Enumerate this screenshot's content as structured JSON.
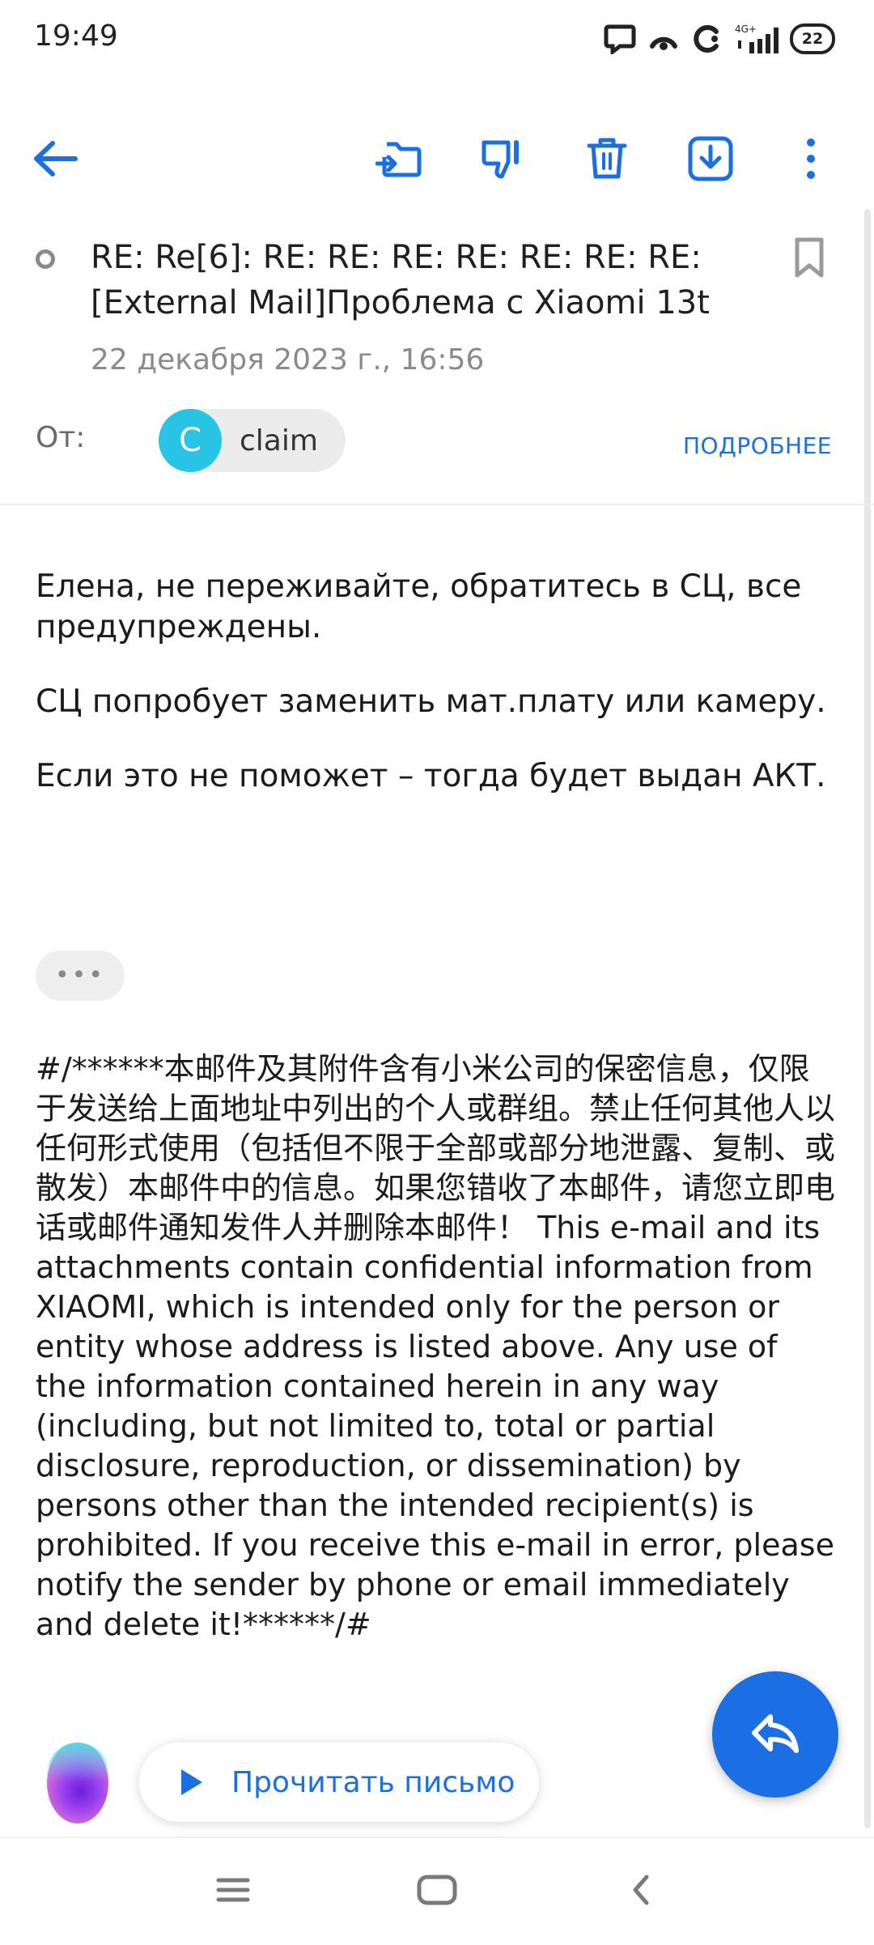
{
  "status_bar": {
    "time": "19:49",
    "network": "4G+",
    "battery": "22"
  },
  "toolbar": {
    "icons": [
      "back-arrow-icon",
      "move-to-folder-icon",
      "spam-thumbs-down-icon",
      "trash-icon",
      "download-icon",
      "more-vert-icon"
    ],
    "accent_color": "#1b6fe0"
  },
  "message": {
    "subject": "RE: Re[6]: RE: RE: RE: RE: RE: RE: RE: [External Mail]Проблема с Xiaomi 13t",
    "date": "22 декабря 2023 г., 16:56",
    "from_label": "От:",
    "sender": {
      "initial": "C",
      "name": "claim",
      "avatar_color": "#29c4e3"
    },
    "details_link": "ПОДРОБНЕЕ"
  },
  "body": {
    "paragraphs": [
      "Елена, не переживайте, обратитесь в СЦ, все предупреждены.",
      "СЦ попробует заменить мат.плату или камеру.",
      "Если это не поможет – тогда будет выдан АКТ."
    ],
    "more_label": "•••",
    "disclaimer": "#/******本邮件及其附件含有小米公司的保密信息，仅限于发送给上面地址中列出的个人或群组。禁止任何其他人以任何形式使用（包括但不限于全部或部分地泄露、复制、或散发）本邮件中的信息。如果您错收了本邮件，请您立即电话或邮件通知发件人并删除本邮件！ This e-mail and its attachments contain confidential information from XIAOMI, which is intended only for the person or entity whose address is listed above. Any use of the information contained herein in any way (including, but not limited to, total or partial disclosure, reproduction, or dissemination) by persons other than the intended recipient(s) is prohibited. If you receive this e-mail in error, please notify the sender by phone or email immediately and delete it!******/#"
  },
  "bottom": {
    "read_label": "Прочитать письмо",
    "reply_icon": "reply-icon"
  },
  "nav": {
    "icons": [
      "menu-icon",
      "home-icon",
      "back-icon"
    ]
  }
}
